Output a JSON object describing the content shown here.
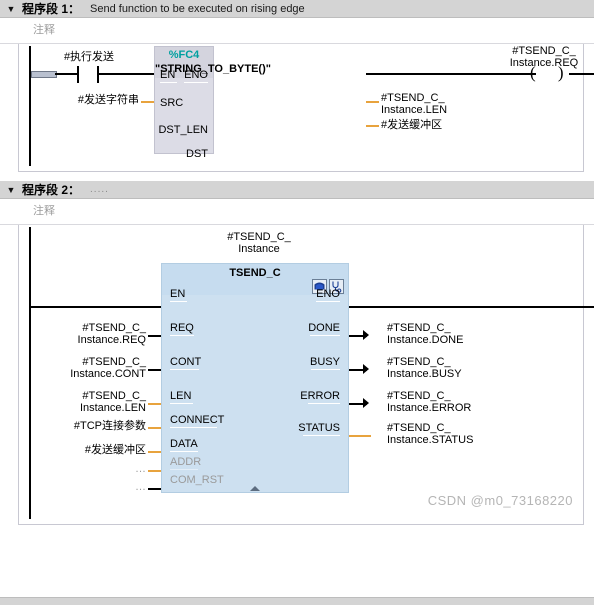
{
  "networks": [
    {
      "collapse_icon": "triangle-down-icon",
      "title": "程序段 1：",
      "subtitle": "Send function to be executed on rising edge",
      "comment_placeholder": "注释",
      "contact": {
        "label": "#执行发送",
        "type": "normally-open-contact"
      },
      "src_label": "#发送字符串",
      "block": {
        "number": "%FC4",
        "name": "\"STRING_TO_BYTE()\"",
        "inputs": [
          {
            "pin": "EN"
          },
          {
            "pin": "SRC"
          }
        ],
        "outputs": [
          {
            "pin": "ENO"
          },
          {
            "pin": "DST_LEN",
            "operand_line1": "#TSEND_C_",
            "operand_line2": "Instance.LEN"
          },
          {
            "pin": "DST",
            "operand_line1": "#发送缓冲区",
            "operand_line2": ""
          }
        ]
      },
      "coil": {
        "label_line1": "#TSEND_C_",
        "label_line2": "Instance.REQ",
        "symbol": "( )"
      }
    },
    {
      "collapse_icon": "triangle-down-icon",
      "title": "程序段 2：",
      "subtitle": ".....",
      "comment_placeholder": "注释",
      "instance_line1": "#TSEND_C_",
      "instance_line2": "Instance",
      "block": {
        "name": "TSEND_C",
        "icons": [
          "open-block-icon",
          "diagnostics-stethoscope-icon"
        ],
        "inputs": [
          {
            "pin": "EN",
            "operand_line1": "",
            "operand_line2": "",
            "dim": false,
            "wire": "black"
          },
          {
            "pin": "REQ",
            "operand_line1": "#TSEND_C_",
            "operand_line2": "Instance.REQ",
            "dim": false,
            "wire": "black"
          },
          {
            "pin": "CONT",
            "operand_line1": "#TSEND_C_",
            "operand_line2": "Instance.CONT",
            "dim": false,
            "wire": "black"
          },
          {
            "pin": "LEN",
            "operand_line1": "#TSEND_C_",
            "operand_line2": "Instance.LEN",
            "dim": false,
            "wire": "orange"
          },
          {
            "pin": "CONNECT",
            "operand_line1": "",
            "operand_line2": "#TCP连接参数",
            "dim": false,
            "wire": "orange"
          },
          {
            "pin": "DATA",
            "operand_line1": "",
            "operand_line2": "#发送缓冲区",
            "dim": false,
            "wire": "orange"
          },
          {
            "pin": "ADDR",
            "operand_line1": "",
            "operand_line2": "…",
            "dim": true,
            "wire": "orange"
          },
          {
            "pin": "COM_RST",
            "operand_line1": "",
            "operand_line2": "…",
            "dim": true,
            "wire": "black"
          }
        ],
        "outputs": [
          {
            "pin": "ENO",
            "operand_line1": "",
            "operand_line2": "",
            "wire": "black"
          },
          {
            "pin": "DONE",
            "operand_line1": "#TSEND_C_",
            "operand_line2": "Instance.DONE",
            "wire": "black"
          },
          {
            "pin": "BUSY",
            "operand_line1": "#TSEND_C_",
            "operand_line2": "Instance.BUSY",
            "wire": "black"
          },
          {
            "pin": "ERROR",
            "operand_line1": "#TSEND_C_",
            "operand_line2": "Instance.ERROR",
            "wire": "black"
          },
          {
            "pin": "STATUS",
            "operand_line1": "#TSEND_C_",
            "operand_line2": "Instance.STATUS",
            "wire": "orange"
          }
        ]
      }
    }
  ],
  "watermark": "CSDN @m0_73168220",
  "colors": {
    "header_bar": "#d4d4d4",
    "fc4_body": "#dcdce6",
    "fc4_head": "#d4d4de",
    "tsend_body": "#cde0f0",
    "tsend_head": "#c6dcef",
    "fc_number_teal": "#00a0a0",
    "wire_orange": "#e8a33d",
    "dim_text": "#9a9a9a"
  }
}
